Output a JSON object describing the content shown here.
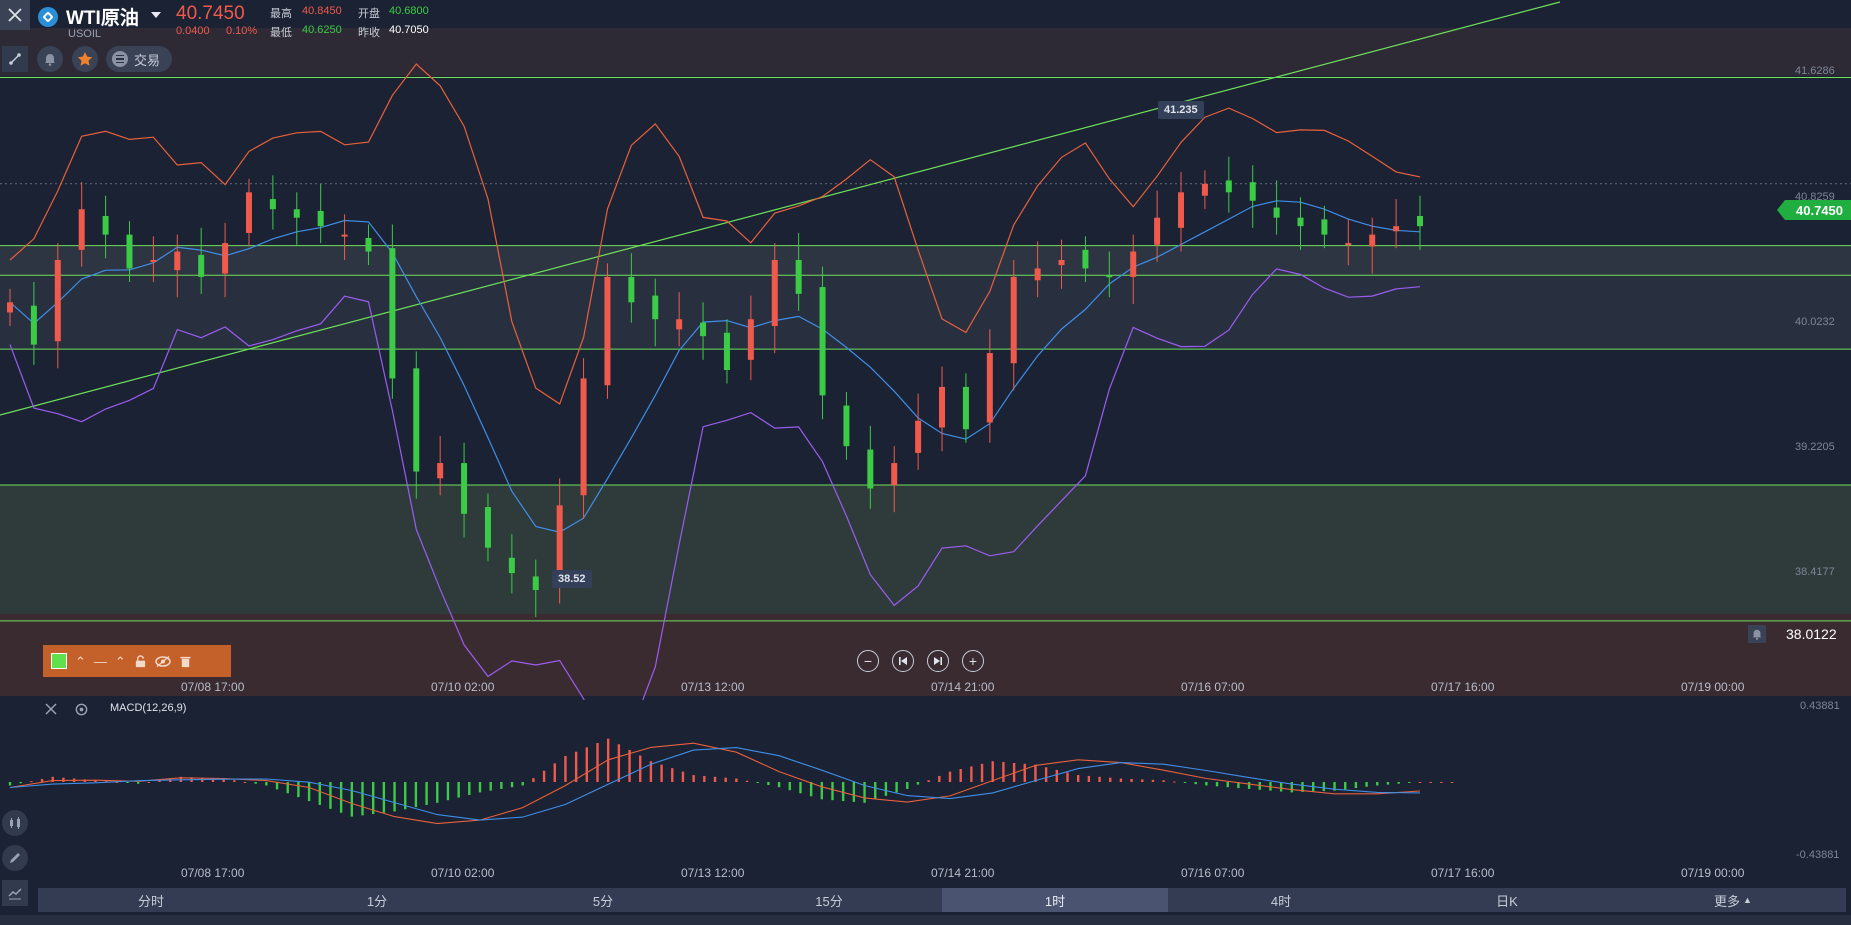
{
  "header": {
    "title": "WTI原油",
    "symbol": "USOIL",
    "price": "40.7450",
    "change": "0.0400",
    "change_pct": "0.10%",
    "stats": {
      "high_label": "最高",
      "high": "40.8450",
      "open_label": "开盘",
      "open": "40.6800",
      "low_label": "最低",
      "low": "40.6250",
      "prev_close_label": "昨收",
      "prev_close": "40.7050"
    }
  },
  "toolbar": {
    "trade_label": "交易"
  },
  "price_axis": {
    "labels": [
      "41.6286",
      "40.8259",
      "40.0232",
      "39.2205",
      "38.4177"
    ],
    "current_price": "40.7450",
    "alert_value": "38.0122"
  },
  "annotations": {
    "high_marker": "41.235",
    "low_marker": "38.52"
  },
  "time_axis": [
    "07/08 17:00",
    "07/10 02:00",
    "07/13 12:00",
    "07/14 21:00",
    "07/16 07:00",
    "07/17 16:00",
    "07/19 00:00"
  ],
  "macd": {
    "label": "MACD(12,26,9)",
    "axis_top": "0.43881",
    "axis_bottom": "-0.43881"
  },
  "timeframes": [
    "分时",
    "1分",
    "5分",
    "15分",
    "1时",
    "4时",
    "日K",
    "更多"
  ],
  "active_timeframe_index": 4,
  "colors": {
    "up": "#ef5a4c",
    "down": "#3bcb46",
    "upper_band": "#e8603c",
    "lower_band": "#9b5cf0",
    "mid_band": "#3f8ee8",
    "hline": "#6fe05a"
  },
  "chart_data": [
    {
      "type": "candlestick",
      "title": "WTI原油",
      "overlays": [
        "bollinger upper",
        "bollinger middle",
        "bollinger lower",
        "trendline",
        "horizontal lines"
      ],
      "ylim": [
        37.95,
        41.85
      ],
      "x_ticks": [
        "07/08 17:00",
        "07/10 02:00",
        "07/13 12:00",
        "07/14 21:00",
        "07/16 07:00",
        "07/17 16:00",
        "07/19 00:00"
      ],
      "horizontal_levels": [
        41.6286,
        40.635,
        40.46,
        40.0232,
        39.2205,
        38.4177,
        37.93
      ],
      "close_trace": [
        40.3,
        40.05,
        40.55,
        40.85,
        40.7,
        40.5,
        40.55,
        40.6,
        40.45,
        40.65,
        40.95,
        40.85,
        40.8,
        40.75,
        40.7,
        40.6,
        39.85,
        39.3,
        39.35,
        39.05,
        38.85,
        38.7,
        38.6,
        39.1,
        39.85,
        40.45,
        40.3,
        40.2,
        40.2,
        40.1,
        39.9,
        40.2,
        40.55,
        40.35,
        39.75,
        39.45,
        39.2,
        39.35,
        39.6,
        39.8,
        39.55,
        40.0,
        40.45,
        40.5,
        40.55,
        40.5,
        40.45,
        40.6,
        40.8,
        40.95,
        41.0,
        40.95,
        40.9,
        40.8,
        40.75,
        40.7,
        40.65,
        40.7,
        40.75,
        40.75
      ],
      "high_marker": 41.235,
      "low_marker": 38.52
    },
    {
      "type": "bar",
      "title": "MACD(12,26,9)",
      "ylim": [
        -0.43881,
        0.43881
      ],
      "histogram": [
        -0.02,
        0.03,
        0.01,
        -0.01,
        0.03,
        0.02,
        -0.02,
        -0.11,
        -0.2,
        -0.17,
        -0.12,
        -0.06,
        -0.02,
        0.15,
        0.25,
        0.12,
        0.04,
        0.02,
        -0.03,
        -0.1,
        -0.12,
        -0.04,
        0.06,
        0.12,
        0.1,
        0.04,
        0.02,
        0.01,
        -0.02,
        -0.04,
        -0.06,
        -0.05,
        -0.02,
        0.0
      ]
    }
  ]
}
